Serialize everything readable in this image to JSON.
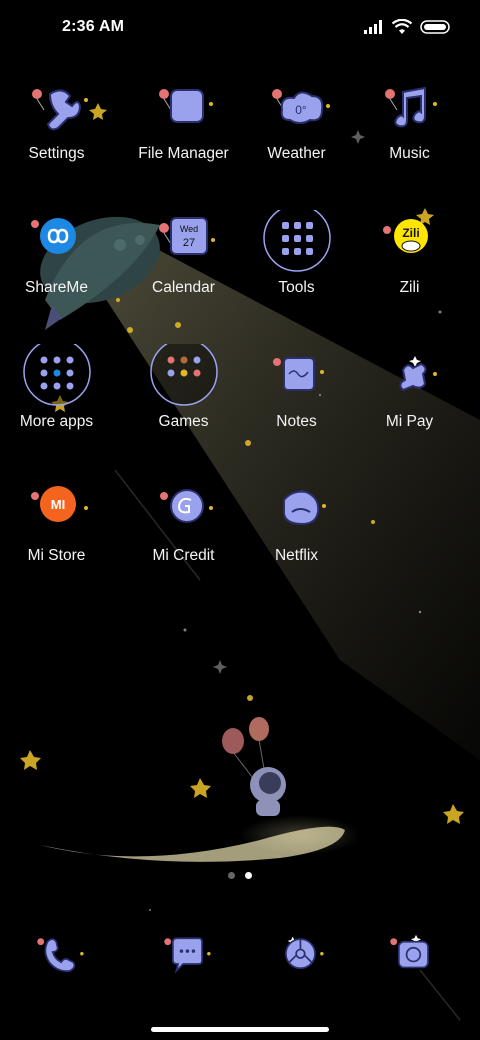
{
  "status_bar": {
    "time": "2:36 AM",
    "icons": [
      "signal-icon",
      "wifi-icon",
      "battery-icon"
    ]
  },
  "apps": [
    {
      "label": "Settings",
      "icon": "wrench-icon"
    },
    {
      "label": "File Manager",
      "icon": "folder-icon"
    },
    {
      "label": "Weather",
      "icon": "cloud-icon",
      "icon_text": "0°"
    },
    {
      "label": "Music",
      "icon": "music-note-icon"
    },
    {
      "label": "ShareMe",
      "icon": "shareme-icon"
    },
    {
      "label": "Calendar",
      "icon": "calendar-icon",
      "icon_day": "Wed",
      "icon_date": "27"
    },
    {
      "label": "Tools",
      "icon": "tools-folder-icon"
    },
    {
      "label": "Zili",
      "icon": "zili-icon",
      "icon_text": "Zili"
    },
    {
      "label": "More apps",
      "icon": "folder-icon"
    },
    {
      "label": "Games",
      "icon": "folder-icon"
    },
    {
      "label": "Notes",
      "icon": "notes-icon"
    },
    {
      "label": "Mi Pay",
      "icon": "mi-pay-icon"
    },
    {
      "label": "Mi Store",
      "icon": "mi-store-icon",
      "icon_text": "MI"
    },
    {
      "label": "Mi Credit",
      "icon": "mi-credit-icon"
    },
    {
      "label": "Netflix",
      "icon": "netflix-icon"
    }
  ],
  "page_indicator": {
    "pages": 2,
    "current": 2
  },
  "dock": [
    {
      "name": "phone",
      "icon": "phone-icon"
    },
    {
      "name": "messages",
      "icon": "message-icon"
    },
    {
      "name": "browser",
      "icon": "browser-icon"
    },
    {
      "name": "camera",
      "icon": "camera-icon"
    }
  ],
  "colors": {
    "icon_fill": "#9aa2ee",
    "icon_stroke": "#2a2f6e",
    "mi_orange": "#f5641e",
    "shareme_blue": "#1e88e5",
    "zili_yellow": "#ffe600"
  }
}
